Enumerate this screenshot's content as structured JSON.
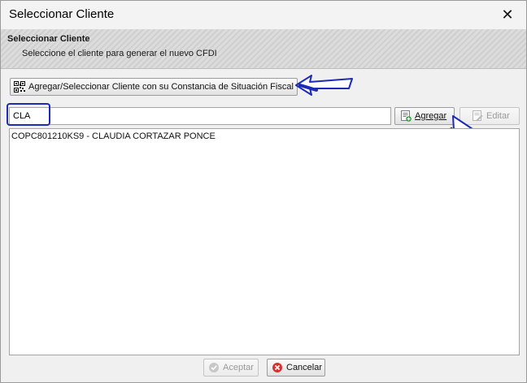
{
  "window": {
    "title": "Seleccionar Cliente",
    "close_label": "✕"
  },
  "header": {
    "title": "Seleccionar Cliente",
    "subtitle": "Seleccione el cliente para generar el nuevo CFDI"
  },
  "toolbar": {
    "constancia_label": "Agregar/Seleccionar Cliente con su Constancia de Situación Fiscal",
    "agregar_label": "Agregar",
    "editar_label": "Editar"
  },
  "search": {
    "value": "CLA"
  },
  "results": [
    {
      "label": "COPC801210KS9 - CLAUDIA CORTAZAR PONCE"
    }
  ],
  "footer": {
    "aceptar_label": "Aceptar",
    "cancelar_label": "Cancelar"
  },
  "icons": {
    "constancia": "qr-code-icon",
    "agregar": "add-document-icon",
    "editar": "edit-document-icon",
    "aceptar": "check-circle-icon",
    "cancelar": "cancel-circle-icon"
  },
  "colors": {
    "annotation": "#1c2bb5",
    "cancel": "#d93030",
    "add": "#2e9a3a"
  }
}
